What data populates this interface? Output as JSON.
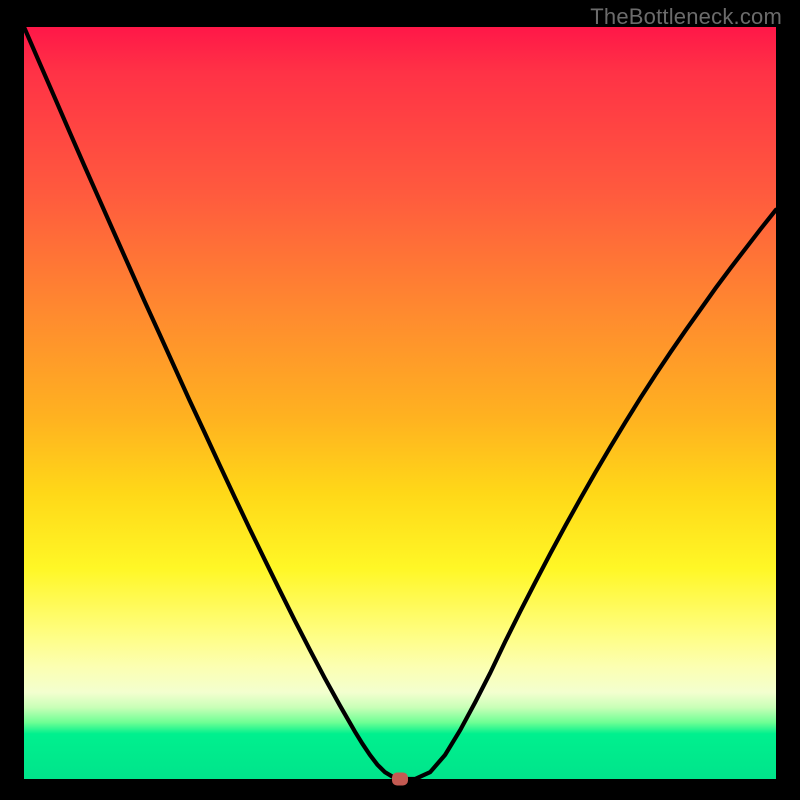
{
  "watermark": {
    "text": "TheBottleneck.com"
  },
  "colors": {
    "frame_bg": "#000000",
    "watermark": "#6b6b6b",
    "curve": "#000000",
    "marker": "#c35a52",
    "gradient_stops": [
      "#ff1748",
      "#ff3246",
      "#ff5a3e",
      "#ff8a2f",
      "#ffb220",
      "#ffd818",
      "#fff726",
      "#fffd7a",
      "#fcffb1",
      "#f3ffcf",
      "#c8ffb7",
      "#6dff94",
      "#00f08e",
      "#00e48b"
    ]
  },
  "chart_data": {
    "type": "line",
    "title": "",
    "xlabel": "",
    "ylabel": "",
    "xlim": [
      0,
      100
    ],
    "ylim": [
      0,
      100
    ],
    "x": [
      0,
      2,
      4,
      6,
      8,
      10,
      12,
      14,
      16,
      18,
      20,
      22,
      24,
      26,
      28,
      30,
      32,
      34,
      36,
      38,
      40,
      42,
      44,
      45,
      46,
      47,
      48,
      49,
      50,
      52,
      54,
      56,
      58,
      60,
      62,
      64,
      66,
      68,
      70,
      72,
      74,
      76,
      78,
      80,
      82,
      84,
      86,
      88,
      90,
      92,
      94,
      96,
      98,
      100
    ],
    "values": [
      100,
      95.4,
      90.8,
      86.2,
      81.6,
      77.1,
      72.6,
      68.1,
      63.6,
      59.2,
      54.8,
      50.4,
      46.1,
      41.8,
      37.5,
      33.3,
      29.2,
      25.1,
      21.1,
      17.2,
      13.4,
      9.8,
      6.3,
      4.7,
      3.2,
      1.9,
      0.9,
      0.3,
      0,
      0,
      0.9,
      3.2,
      6.5,
      10.2,
      14.1,
      18.3,
      22.3,
      26.2,
      30.0,
      33.7,
      37.3,
      40.8,
      44.2,
      47.5,
      50.7,
      53.8,
      56.8,
      59.7,
      62.5,
      65.3,
      68.0,
      70.6,
      73.2,
      75.7
    ],
    "marker": {
      "x": 50,
      "y": 0
    },
    "notes": "Axes unlabeled in source; x/y are normalized 0–100 estimates from pixel positions."
  }
}
